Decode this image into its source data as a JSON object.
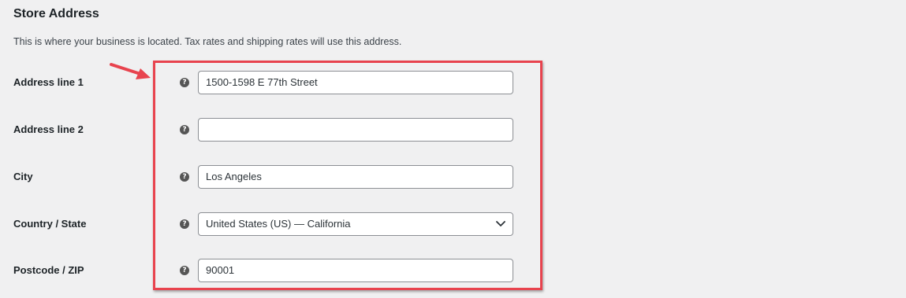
{
  "section": {
    "title": "Store Address",
    "description": "This is where your business is located. Tax rates and shipping rates will use this address."
  },
  "fields": [
    {
      "label": "Address line 1",
      "value": "1500-1598 E 77th Street",
      "type": "text"
    },
    {
      "label": "Address line 2",
      "value": "",
      "type": "text"
    },
    {
      "label": "City",
      "value": "Los Angeles",
      "type": "text"
    },
    {
      "label": "Country / State",
      "value": "United States (US) — California",
      "type": "select"
    },
    {
      "label": "Postcode / ZIP",
      "value": "90001",
      "type": "text"
    }
  ],
  "icons": {
    "help": "help-tip-icon",
    "dropdown": "chevron-down-icon",
    "annotation": "red-arrow-icon"
  },
  "colors": {
    "highlight": "#e8434e",
    "background": "#f0f0f1",
    "help_icon": "#555555"
  }
}
